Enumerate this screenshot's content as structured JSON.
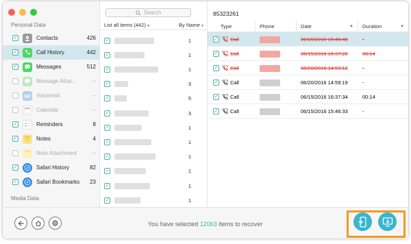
{
  "colors": {
    "accent": "#3eb3a4",
    "selected_row": "#d3e8ee",
    "deleted_text": "#d9352b",
    "highlight": "#f39a1e",
    "action_button": "#38b6cf"
  },
  "sidebar": {
    "section_personal": "Personal Data",
    "section_media": "Media Data",
    "items": [
      {
        "label": "Contacts",
        "count": "426",
        "icon": "contacts-icon",
        "checked": true
      },
      {
        "label": "Call History",
        "count": "442",
        "icon": "phone-icon",
        "checked": true
      },
      {
        "label": "Messages",
        "count": "512",
        "icon": "messages-icon",
        "checked": true
      },
      {
        "label": "Message Attac...",
        "count": "--",
        "icon": "message-attachment-icon",
        "checked": false
      },
      {
        "label": "Voicemail",
        "count": "--",
        "icon": "voicemail-icon",
        "checked": false
      },
      {
        "label": "Calendar",
        "count": "--",
        "icon": "calendar-icon",
        "checked": false
      },
      {
        "label": "Reminders",
        "count": "8",
        "icon": "reminders-icon",
        "checked": true
      },
      {
        "label": "Notes",
        "count": "4",
        "icon": "notes-icon",
        "checked": true
      },
      {
        "label": "Note Attachment",
        "count": "--",
        "icon": "note-attachment-icon",
        "checked": false
      },
      {
        "label": "Safari History",
        "count": "82",
        "icon": "safari-icon",
        "checked": true
      },
      {
        "label": "Safari Bookmarks",
        "count": "23",
        "icon": "safari-bookmarks-icon",
        "checked": true
      }
    ]
  },
  "middle": {
    "search_placeholder": "Search",
    "list_label": "List all items (442)",
    "sort_label": "By Name",
    "counts": [
      "1",
      "1",
      "1",
      "3",
      "5",
      "3",
      "1",
      "1",
      "1",
      "1",
      "1",
      "1"
    ]
  },
  "detail": {
    "title": "85323261",
    "columns": {
      "type": "Type",
      "phone": "Phone",
      "date": "Date",
      "duration": "Duration"
    },
    "rows": [
      {
        "type": "Call",
        "date": "06/15/2016 15:46:40",
        "duration": "-",
        "deleted": true,
        "selected": true
      },
      {
        "type": "Call",
        "date": "06/15/2016 16:37:20",
        "duration": "00:14",
        "deleted": true,
        "selected": false
      },
      {
        "type": "Call",
        "date": "06/20/2016 14:59:12",
        "duration": "-",
        "deleted": true,
        "selected": false
      },
      {
        "type": "Call",
        "date": "06/20/2016 14:59:19",
        "duration": "-",
        "deleted": false,
        "selected": false
      },
      {
        "type": "Call",
        "date": "06/15/2016 16:37:34",
        "duration": "00:14",
        "deleted": false,
        "selected": false
      },
      {
        "type": "Call",
        "date": "06/15/2016 15:46:33",
        "duration": "-",
        "deleted": false,
        "selected": false
      }
    ]
  },
  "footer": {
    "status_prefix": "You have selected",
    "status_count": "12063",
    "status_suffix": "items to recover"
  }
}
